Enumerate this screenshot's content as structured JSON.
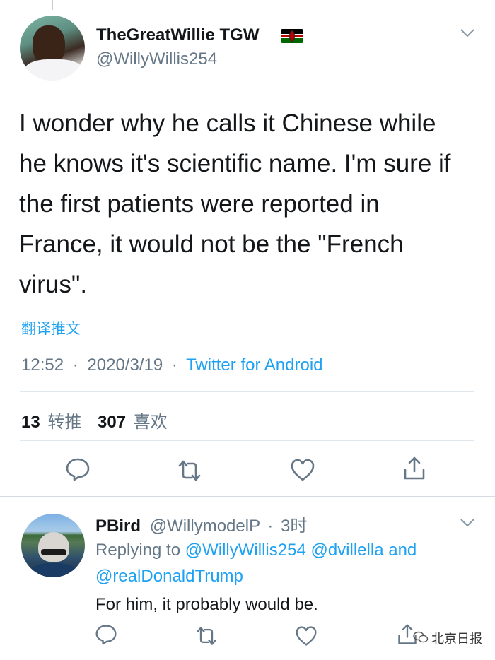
{
  "tweet": {
    "display_name": "TheGreatWillie TGW",
    "handle": "@WillyWillis254",
    "text": "I wonder why he calls it Chinese while\nhe knows it's scientific name. I'm sure if\nthe first patients were reported in\nFrance, it would not be the \"French\nvirus\".",
    "translate_label": "翻译推文",
    "time": "12:52",
    "date": "2020/3/19",
    "dot": "·",
    "source": "Twitter for Android",
    "retweets_count": "13",
    "retweets_label": "转推",
    "likes_count": "307",
    "likes_label": "喜欢",
    "flag_icon": "kenya-flag-icon"
  },
  "reply": {
    "display_name": "PBird",
    "handle": "@WillymodelP",
    "age": "3时",
    "dot": "·",
    "replying_prefix": "Replying to",
    "mentions": [
      "@WillyWillis254",
      "@dvillella",
      "@realDonaldTrump"
    ],
    "and_word": "and",
    "text": "For him, it probably would be."
  },
  "watermark": {
    "text": "北京日报"
  },
  "colors": {
    "accent": "#1da1f2",
    "secondary_text": "#657786",
    "divider": "#e1e8ed"
  }
}
